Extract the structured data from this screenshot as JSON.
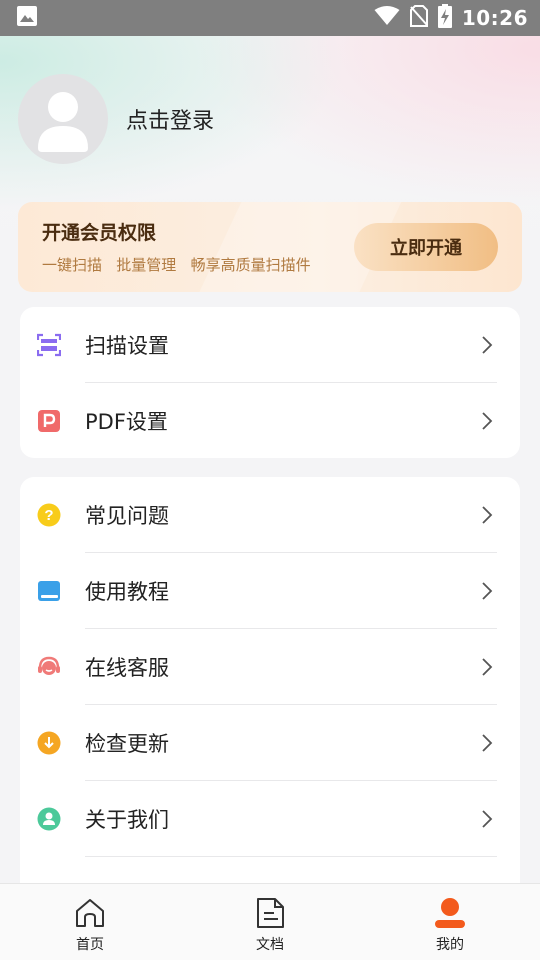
{
  "status_bar": {
    "time": "10:26",
    "icons": [
      "image-icon",
      "wifi-icon",
      "no-sim-icon",
      "battery-charging-icon"
    ]
  },
  "profile": {
    "login_label": "点击登录",
    "avatar_icon": "person-icon"
  },
  "vip": {
    "title": "开通会员权限",
    "subtitle": "一键扫描   批量管理   畅享高质量扫描件",
    "button_label": "立即开通",
    "colors": {
      "card_bg": "#fde9d6",
      "button_bg": "#f1be84",
      "title": "#4a2c10",
      "subtitle": "#b07a40"
    }
  },
  "settings_group": {
    "items": [
      {
        "label": "扫描设置",
        "icon": "scan-icon"
      },
      {
        "label": "PDF设置",
        "icon": "pdf-icon"
      }
    ]
  },
  "support_group": {
    "items": [
      {
        "label": "常见问题",
        "icon": "question-icon"
      },
      {
        "label": "使用教程",
        "icon": "book-icon"
      },
      {
        "label": "在线客服",
        "icon": "headset-icon"
      },
      {
        "label": "检查更新",
        "icon": "download-icon"
      },
      {
        "label": "关于我们",
        "icon": "about-icon"
      }
    ]
  },
  "tabbar": {
    "tabs": [
      {
        "label": "首页",
        "icon": "home-icon",
        "active": false
      },
      {
        "label": "文档",
        "icon": "document-icon",
        "active": false
      },
      {
        "label": "我的",
        "icon": "profile-icon",
        "active": true
      }
    ],
    "active_color": "#f35a1c"
  }
}
